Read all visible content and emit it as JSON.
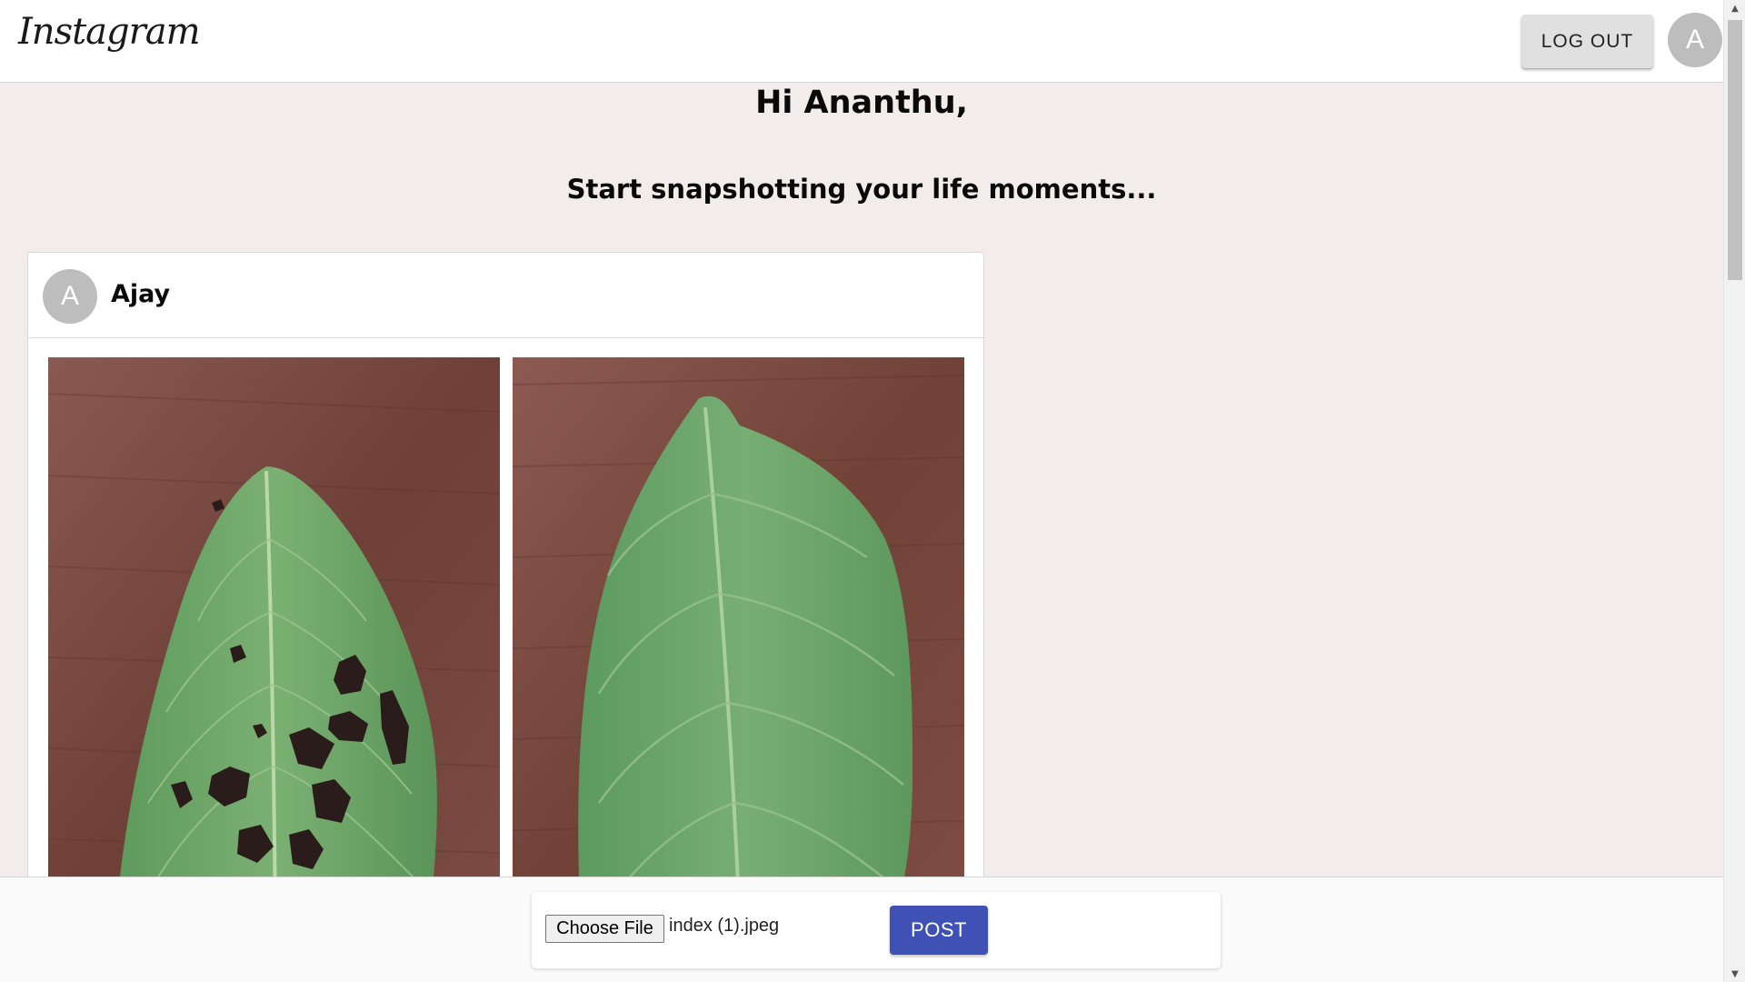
{
  "header": {
    "logo_text": "Instagram",
    "logout_label": "LOG OUT",
    "avatar_initial": "A"
  },
  "main": {
    "greeting": "Hi Ananthu,",
    "tagline": "Start snapshotting your life moments..."
  },
  "post": {
    "avatar_initial": "A",
    "username": "Ajay",
    "images": [
      {
        "name": "leaf-with-holes-image"
      },
      {
        "name": "healthy-leaf-image"
      }
    ]
  },
  "upload": {
    "choose_file_label": "Choose File",
    "file_name": "index (1).jpeg",
    "post_label": "POST"
  },
  "colors": {
    "page_background": "#f2ecec",
    "post_button": "#3f51b5",
    "avatar": "#bdbdbd",
    "leaf_green": "#6ea36b",
    "wood_brown": "#7a4a40"
  }
}
